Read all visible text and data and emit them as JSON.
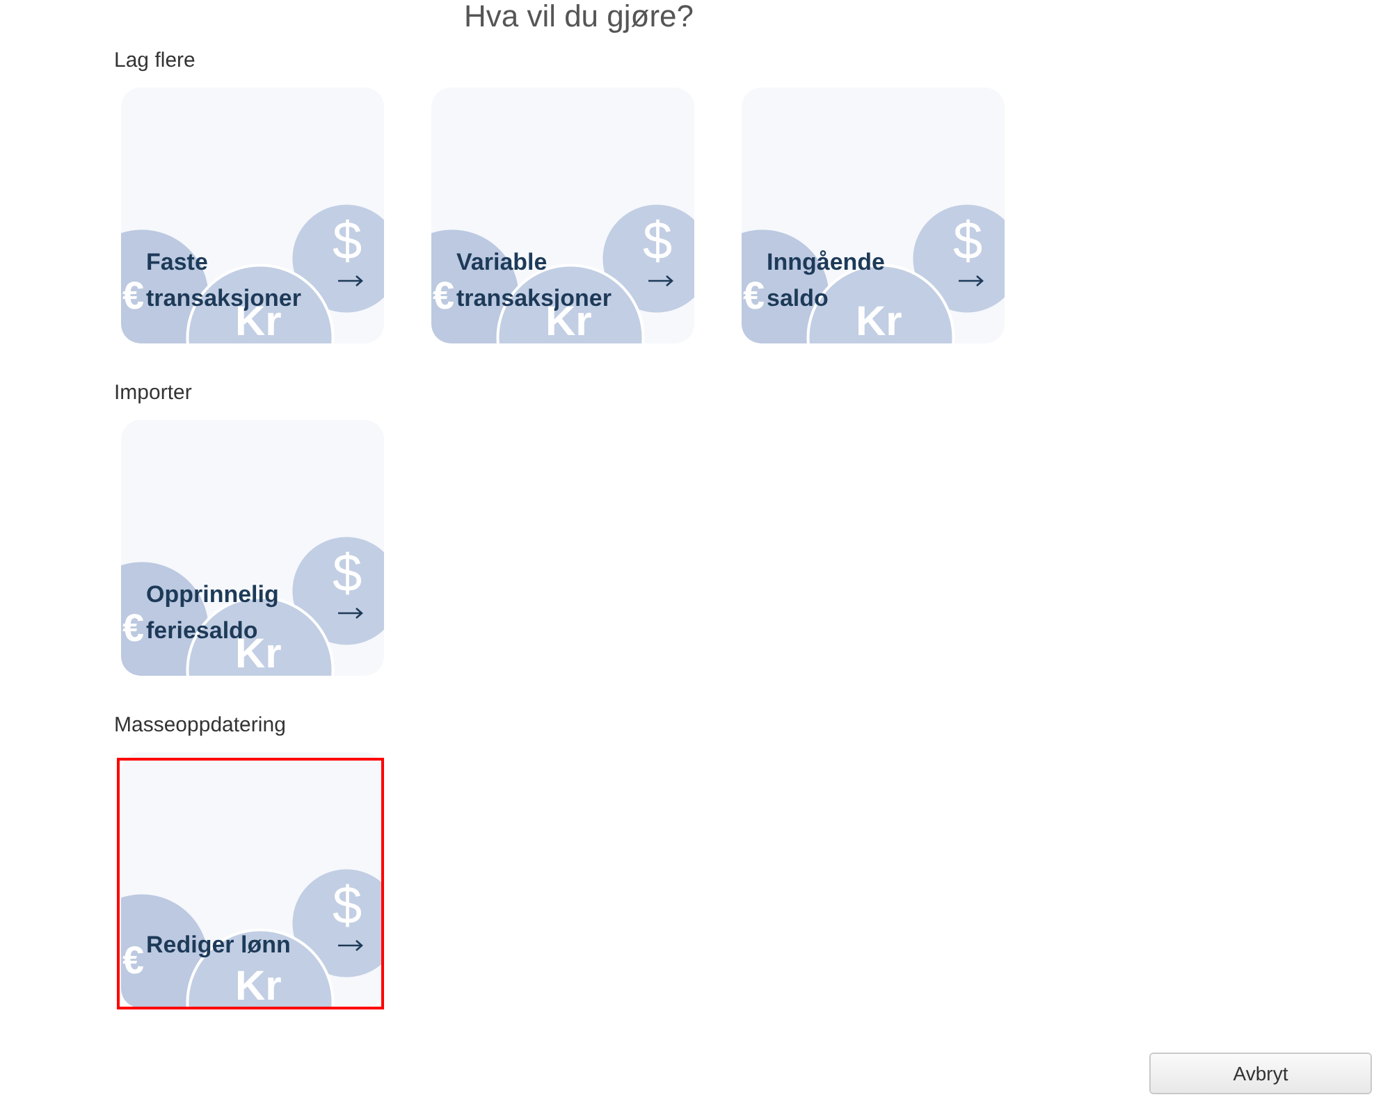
{
  "page": {
    "title": "Hva vil du gjøre?"
  },
  "sections": [
    {
      "label": "Lag flere",
      "cards": [
        {
          "title": "Faste transaksjoner",
          "highlighted": false,
          "coins": [
            "€",
            "Kr",
            "$"
          ]
        },
        {
          "title": "Variable transaksjoner",
          "highlighted": false,
          "coins": [
            "€",
            "Kr",
            "$"
          ]
        },
        {
          "title": "Inngående saldo",
          "highlighted": false,
          "coins": [
            "€",
            "Kr",
            "$"
          ]
        }
      ]
    },
    {
      "label": "Importer",
      "cards": [
        {
          "title": "Opprinnelig feriesaldo",
          "highlighted": false,
          "coins": [
            "€",
            "Kr",
            "$"
          ]
        }
      ]
    },
    {
      "label": "Masseoppdatering",
      "cards": [
        {
          "title": "Rediger lønn",
          "highlighted": true,
          "coins": [
            "€",
            "Kr",
            "$"
          ]
        }
      ]
    }
  ],
  "footer": {
    "cancel_button": "Avbryt"
  }
}
